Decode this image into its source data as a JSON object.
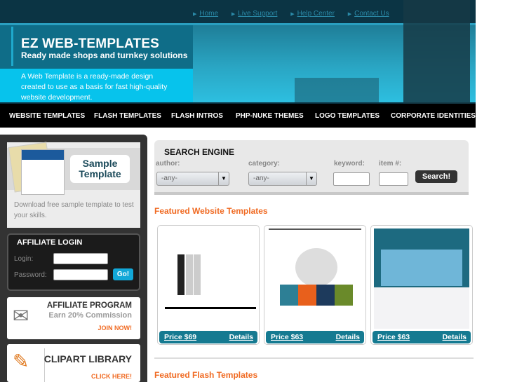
{
  "header": {
    "top_links": [
      "Home",
      "Live Support",
      "Help Center",
      "Contact Us"
    ],
    "brand_title": "EZ WEB-TEMPLATES",
    "brand_tagline": "Ready made shops and turnkey solutions",
    "intro": "A Web Template is a ready-made design created to use as a basis for fast high-quality website development."
  },
  "nav": [
    "WEBSITE TEMPLATES",
    "FLASH TEMPLATES",
    "FLASH INTROS",
    "PHP-NUKE THEMES",
    "LOGO TEMPLATES",
    "CORPORATE IDENTITIES"
  ],
  "sidebar": {
    "sample": {
      "label_line1": "Sample",
      "label_line2": "Template",
      "desc": "Download free sample template to test your skills."
    },
    "login": {
      "title": "AFFILIATE LOGIN",
      "login_label": "Login:",
      "password_label": "Password:",
      "login_value": "",
      "password_value": "",
      "go": "Go!"
    },
    "affiliate": {
      "title": "AFFILIATE PROGRAM",
      "subtitle": "Earn 20% Commission",
      "cta": "JOIN NOW!"
    },
    "clipart": {
      "title": "CLIPART LIBRARY",
      "cta": "CLICK HERE!"
    }
  },
  "search": {
    "title": "SEARCH ENGINE",
    "author_label": "author:",
    "author_value": "-any-",
    "category_label": "category:",
    "category_value": "-any-",
    "keyword_label": "keyword:",
    "keyword_value": "",
    "item_label": "item #:",
    "item_value": "",
    "button": "Search!"
  },
  "featured_website": {
    "title": "Featured Website Templates",
    "items": [
      {
        "price": "Price $69",
        "details": "Details"
      },
      {
        "price": "Price $63",
        "details": "Details"
      },
      {
        "price": "Price $63",
        "details": "Details"
      }
    ]
  },
  "featured_flash": {
    "title": "Featured Flash Templates"
  },
  "colors": {
    "accent": "#f06a22",
    "teal": "#157a91",
    "cyan": "#07c3ec",
    "nav_bg": "#000000"
  }
}
